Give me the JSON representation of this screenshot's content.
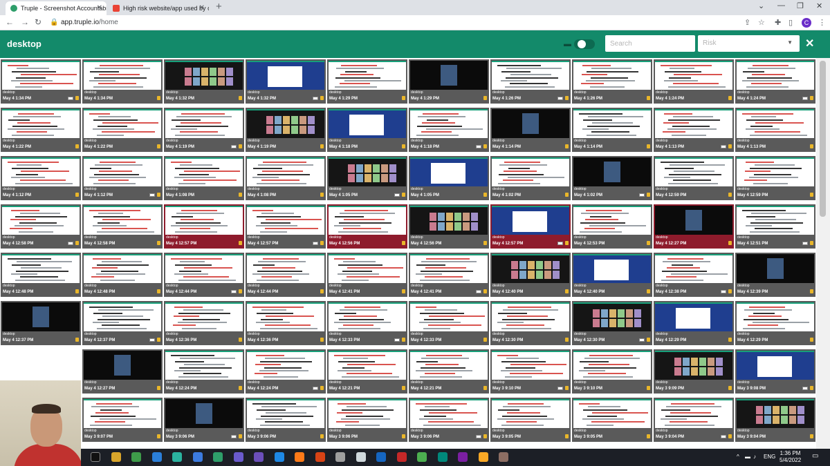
{
  "browser": {
    "tabs": [
      {
        "title": "Truple - Screenshot Accountabil",
        "active": true
      },
      {
        "title": "High risk website/app used by co",
        "active": false
      }
    ],
    "url_host": "app.truple.io",
    "url_path": "/home",
    "profile_initial": "C"
  },
  "header": {
    "title": "desktop",
    "search_placeholder": "Search",
    "risk_placeholder": "Risk",
    "accent": "#138a6a"
  },
  "grid": {
    "columns": 10,
    "rows": [
      {
        "times": [
          "May 4 1:34 PM",
          "May 4 1:34 PM",
          "May 4 1:32 PM",
          "May 4 1:32 PM",
          "May 4 1:29 PM",
          "May 4 1:29 PM",
          "May 4 1:26 PM",
          "May 4 1:26 PM",
          "May 4 1:24 PM",
          "May 4 1:24 PM"
        ]
      },
      {
        "times": [
          "May 4 1:22 PM",
          "May 4 1:22 PM",
          "May 4 1:19 PM",
          "May 4 1:19 PM",
          "May 4 1:18 PM",
          "May 4 1:18 PM",
          "May 4 1:14 PM",
          "May 4 1:14 PM",
          "May 4 1:13 PM",
          "May 4 1:13 PM"
        ]
      },
      {
        "times": [
          "May 4 1:12 PM",
          "May 4 1:12 PM",
          "May 4 1:08 PM",
          "May 4 1:08 PM",
          "May 4 1:05 PM",
          "May 4 1:05 PM",
          "May 4 1:02 PM",
          "May 4 1:02 PM",
          "May 4 12:59 PM",
          "May 4 12:59 PM"
        ]
      },
      {
        "times": [
          "May 4 12:58 PM",
          "May 4 12:58 PM",
          "May 4 12:57 PM",
          "May 4 12:57 PM",
          "May 4 12:56 PM",
          "May 4 12:56 PM",
          "May 4 12:57 PM",
          "May 4 12:53 PM",
          "May 4 12:27 PM",
          "May 4 12:51 PM"
        ]
      },
      {
        "times": [
          "May 4 12:48 PM",
          "May 4 12:48 PM",
          "May 4 12:44 PM",
          "May 4 12:44 PM",
          "May 4 12:41 PM",
          "May 4 12:41 PM",
          "May 4 12:40 PM",
          "May 4 12:40 PM",
          "May 4 12:38 PM",
          "May 4 12:39 PM"
        ]
      },
      {
        "times": [
          "May 4 12:37 PM",
          "May 4 12:37 PM",
          "May 4 12:36 PM",
          "May 4 12:36 PM",
          "May 4 12:33 PM",
          "May 4 12:33 PM",
          "May 4 12:30 PM",
          "May 4 12:30 PM",
          "May 4 12:29 PM",
          "May 4 12:29 PM"
        ]
      },
      {
        "times": [
          "",
          "May 4 12:27 PM",
          "May 4 12:24 PM",
          "May 4 12:24 PM",
          "May 4 12:21 PM",
          "May 4 12:21 PM",
          "May 3 9:10 PM",
          "May 3 9:10 PM",
          "May 3 9:09 PM",
          "May 3 9:08 PM"
        ]
      },
      {
        "times": [
          "",
          "May 3 9:07 PM",
          "May 3 9:06 PM",
          "May 3 9:06 PM",
          "May 3 9:06 PM",
          "May 3 9:06 PM",
          "May 3 9:05 PM",
          "May 3 9:05 PM",
          "May 3 9:04 PM",
          "May 3 9:04 PM"
        ]
      }
    ],
    "caption": "desktop",
    "flagged_tiles": [
      [
        3,
        2
      ],
      [
        3,
        4
      ],
      [
        3,
        6
      ],
      [
        3,
        8
      ]
    ],
    "flag_color": "#8e1b2c"
  },
  "taskbar": {
    "tray_lang": "ENG",
    "clock_time": "1:36 PM",
    "clock_date": "5/4/2022"
  }
}
